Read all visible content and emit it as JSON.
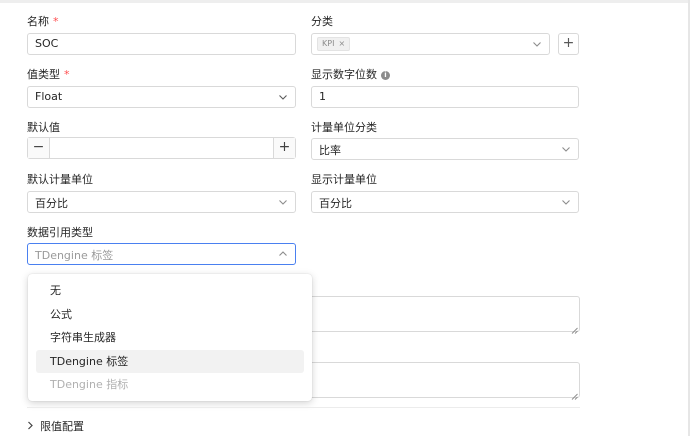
{
  "fields": {
    "name": {
      "label": "名称",
      "required_mark": "*",
      "value": "SOC"
    },
    "category": {
      "label": "分类",
      "tag": "KPI",
      "tag_remove": "×",
      "add_button": "+"
    },
    "value_type": {
      "label": "值类型",
      "required_mark": "*",
      "value": "Float"
    },
    "display_digits": {
      "label": "显示数字位数",
      "info_icon": "i",
      "value": "1"
    },
    "default_value": {
      "label": "默认值",
      "minus": "−",
      "plus": "+",
      "value": ""
    },
    "unit_category": {
      "label": "计量单位分类",
      "value": "比率"
    },
    "default_unit": {
      "label": "默认计量单位",
      "value": "百分比"
    },
    "display_unit": {
      "label": "显示计量单位",
      "value": "百分比"
    },
    "data_ref_type": {
      "label": "数据引用类型",
      "value": "TDengine 标签"
    }
  },
  "dropdown": {
    "options": [
      {
        "label": "无",
        "state": "normal"
      },
      {
        "label": "公式",
        "state": "normal"
      },
      {
        "label": "字符串生成器",
        "state": "normal"
      },
      {
        "label": "TDengine 标签",
        "state": "active"
      },
      {
        "label": "TDengine 指标",
        "state": "disabled"
      }
    ]
  },
  "sections": {
    "limits": {
      "label": "限值配置",
      "icon": "chevron-right-icon"
    }
  },
  "colors": {
    "required": "#ff4d4f",
    "focus_border": "#4a80f0",
    "active_option_bg": "#f2f2f2"
  }
}
